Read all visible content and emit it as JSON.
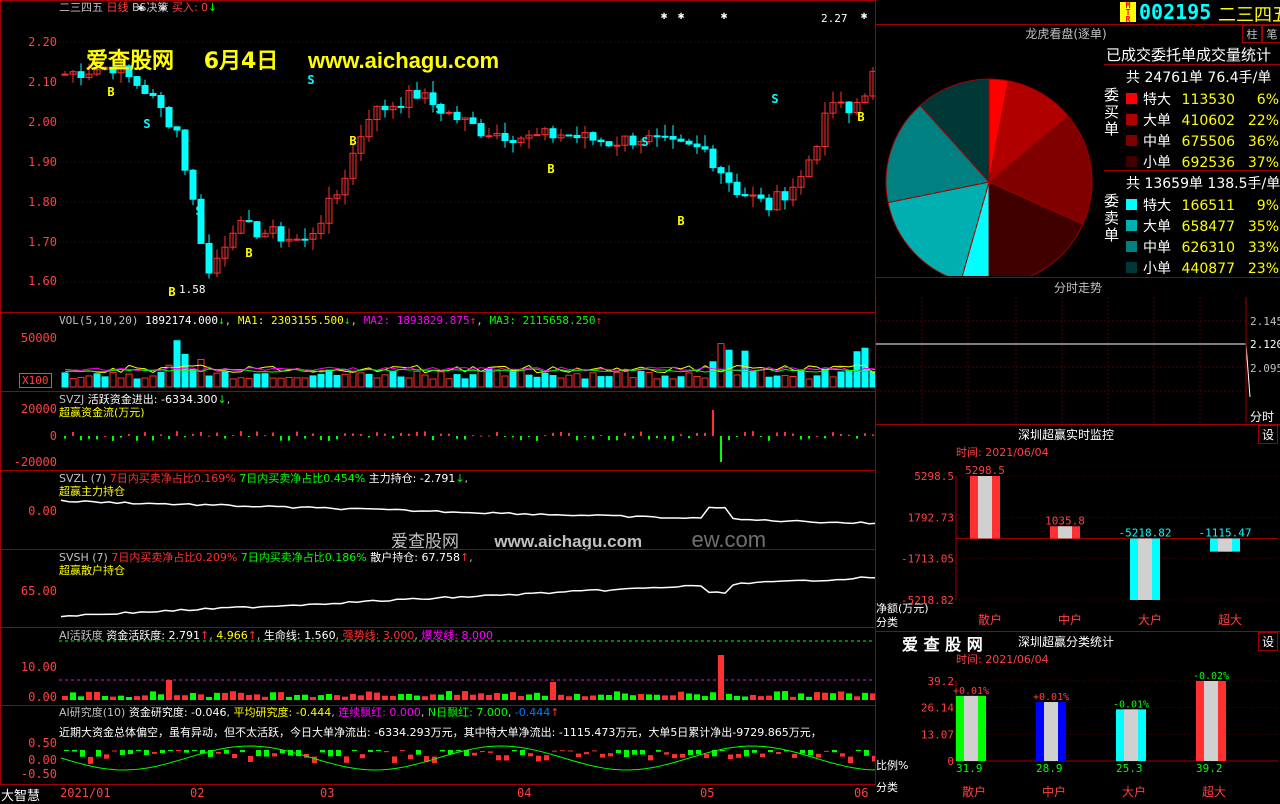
{
  "header": {
    "stock_name": "二三四五",
    "line_type": "日线",
    "bs_label": "BS决策",
    "buy_label": "买入: 0",
    "code": "002195",
    "name": "二三四五",
    "btn_zhu": "柱",
    "btn_bi": "笔",
    "badge": "MTR"
  },
  "watermark": {
    "title": "爱查股网",
    "date": "6月4日",
    "url": "www.aichagu.com",
    "mid_title": "爱查股网",
    "mid_url": "www.aichagu.com",
    "mid_extra": "ew.com"
  },
  "price_axis": [
    "2.20",
    "2.10",
    "2.00",
    "1.90",
    "1.80",
    "1.70",
    "1.60"
  ],
  "price_labels": {
    "high": "2.27",
    "low": "1.58"
  },
  "vol": {
    "title": "VOL(5,10,20)",
    "value": "1892174.000",
    "ma1": "MA1: 2303155.500",
    "ma2": "MA2: 1893829.875",
    "ma3": "MA3: 2115658.250",
    "axis": [
      "50000",
      "X100"
    ]
  },
  "svzj": {
    "title": "SVZJ",
    "l1": "活跃资金进出: -6334.300",
    "l2": "超赢资金流(万元)",
    "axis": [
      "20000",
      "0",
      "-20000"
    ]
  },
  "svzl": {
    "title": "SVZL (7)",
    "t1": "7日内买卖净占比0.169%",
    "t2": "7日内买卖净占比0.454%",
    "t3": "主力持仓: -2.791",
    "sub": "超赢主力持仓",
    "axis": [
      "0.00"
    ]
  },
  "svsh": {
    "title": "SVSH (7)",
    "t1": "7日内买卖净占比0.209%",
    "t2": "7日内买卖净占比0.186%",
    "t3": "散户持仓: 67.758",
    "sub": "超赢散户持仓",
    "axis": [
      "65.00"
    ]
  },
  "active": {
    "title": "AI活跃度",
    "l1": "资金活跃度: 2.791",
    "l2": "4.966",
    "l3": "生命线: 1.560",
    "l4": "强势线: 3.000",
    "l5": "爆发线: 8.000",
    "axis": [
      "10.00",
      "5.00",
      "0.00"
    ]
  },
  "research": {
    "title": "AI研究度(10)",
    "l1": "资金研究度: -0.046",
    "l2": "平均研究度: -0.444",
    "l3": "连续飘红: 0.000",
    "l4": "N日飘红: 7.000",
    "l5": "-0.444",
    "desc": "近期大资金总体偏空，虽有异动，但不太活跃，今日大单净流出: -6334.293万元，其中特大单净流出: -1115.473万元，大单5日累计净出-9729.865万元，",
    "axis": [
      "0.50",
      "0.00",
      "-0.50"
    ]
  },
  "dates": [
    "2021/01",
    "02",
    "03",
    "04",
    "05",
    "06"
  ],
  "footer_brand": "大智慧",
  "right": {
    "lhkp": {
      "title": "龙虎看盘(逐单)",
      "stat_title": "已成交委托单成交量统计",
      "buy_side": "委买单",
      "sell_side": "委卖单",
      "buy_total": "共 24761单 76.4手/单",
      "sell_total": "共 13659单 138.5手/单",
      "buy_rows": [
        {
          "name": "特大",
          "vol": "113530",
          "pct": "6%",
          "color": "#ff0000"
        },
        {
          "name": "大单",
          "vol": "410602",
          "pct": "22%",
          "color": "#b00000"
        },
        {
          "name": "中单",
          "vol": "675506",
          "pct": "36%",
          "color": "#800000"
        },
        {
          "name": "小单",
          "vol": "692536",
          "pct": "37%",
          "color": "#400000"
        }
      ],
      "sell_rows": [
        {
          "name": "特大",
          "vol": "166511",
          "pct": "9%",
          "color": "#00ffff"
        },
        {
          "name": "大单",
          "vol": "658477",
          "pct": "35%",
          "color": "#00b0b0"
        },
        {
          "name": "中单",
          "vol": "626310",
          "pct": "33%",
          "color": "#008080"
        },
        {
          "name": "小单",
          "vol": "440877",
          "pct": "23%",
          "color": "#003838"
        }
      ]
    },
    "fenshi": {
      "title": "分时走势",
      "axis": [
        "2.145",
        "2.120",
        "2.095"
      ],
      "bottom": "分时"
    },
    "monitor": {
      "title": "深圳超赢实时监控",
      "set": "设",
      "time": "时间: 2021/06/04",
      "axis": [
        "5298.5",
        "1792.73",
        "-1713.05",
        "-5218.82"
      ],
      "ylabel": "净额(万元)",
      "xlabel": "分类",
      "bars": [
        {
          "cat": "散户",
          "val": "5298.5"
        },
        {
          "cat": "中户",
          "val": "1035.8"
        },
        {
          "cat": "大户",
          "val": "-5218.82"
        },
        {
          "cat": "超大",
          "val": "-1115.47"
        }
      ]
    },
    "classify": {
      "brand": "爱 查 股 网",
      "title": "深圳超赢分类统计",
      "set": "设",
      "time": "时间: 2021/06/04",
      "axis": [
        "39.2",
        "26.14",
        "13.07",
        "0"
      ],
      "ylabel": "比例%",
      "xlabel": "分类",
      "bars": [
        {
          "cat": "散户",
          "val": "31.9",
          "chg": "+0.01%"
        },
        {
          "cat": "中户",
          "val": "28.9",
          "chg": "+0.01%"
        },
        {
          "cat": "大户",
          "val": "25.3",
          "chg": "-0.01%"
        },
        {
          "cat": "超大",
          "val": "39.2",
          "chg": "-0.02%"
        }
      ]
    }
  },
  "chart_data": [
    {
      "type": "bar",
      "title": "深圳超赢实时监控",
      "categories": [
        "散户",
        "中户",
        "大户",
        "超大"
      ],
      "values": [
        5298.5,
        1035.8,
        -5218.82,
        -1115.47
      ],
      "ylabel": "净额(万元)",
      "xlabel": "分类",
      "ylim": [
        -5218.82,
        5298.5
      ]
    },
    {
      "type": "bar",
      "title": "深圳超赢分类统计",
      "categories": [
        "散户",
        "中户",
        "大户",
        "超大"
      ],
      "values": [
        31.9,
        28.9,
        25.3,
        39.2
      ],
      "ylabel": "比例%",
      "xlabel": "分类",
      "ylim": [
        0,
        39.2
      ]
    },
    {
      "type": "pie",
      "title": "龙虎看盘(逐单)",
      "categories": [
        "特大买",
        "大单买",
        "中单买",
        "小单买",
        "特大卖",
        "大单卖",
        "中单卖",
        "小单卖"
      ],
      "values": [
        113530,
        410602,
        675506,
        692536,
        166511,
        658477,
        626310,
        440877
      ]
    }
  ]
}
